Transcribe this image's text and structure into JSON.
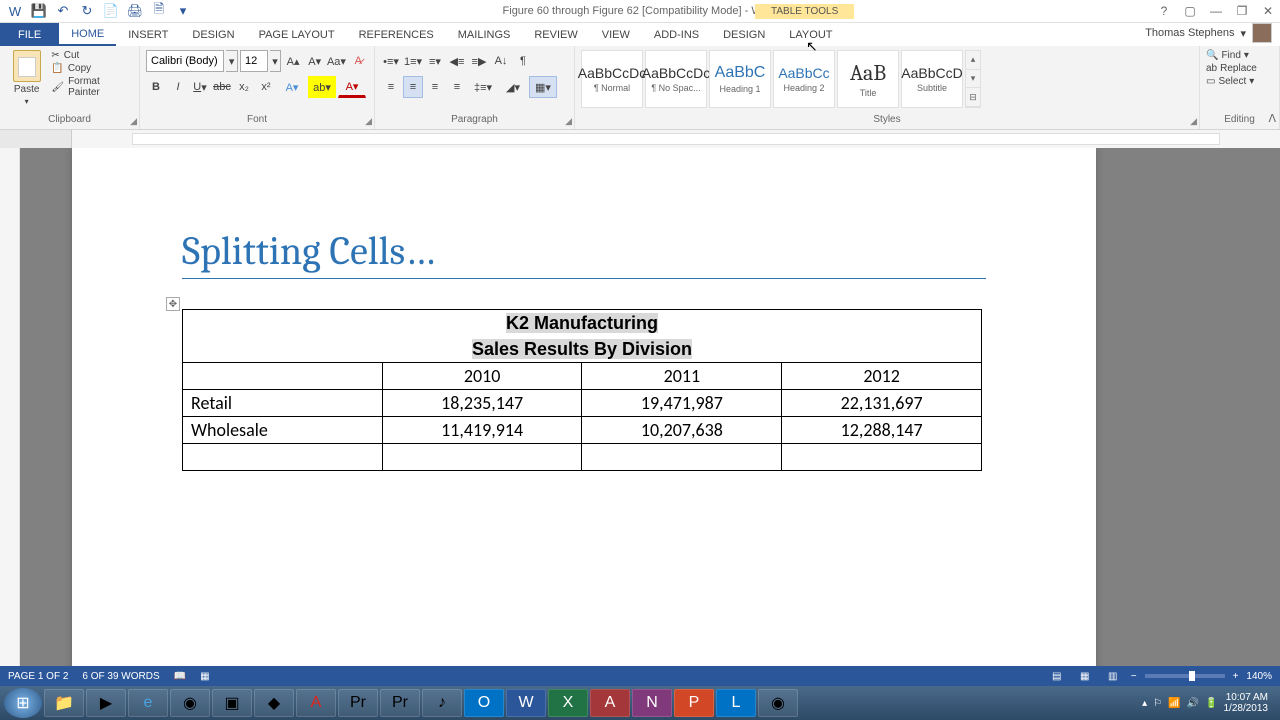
{
  "window": {
    "title": "Figure 60 through Figure 62 [Compatibility Mode] - Word",
    "table_tools": "TABLE TOOLS",
    "user": "Thomas Stephens"
  },
  "tabs": {
    "file": "FILE",
    "home": "HOME",
    "insert": "INSERT",
    "design": "DESIGN",
    "page_layout": "PAGE LAYOUT",
    "references": "REFERENCES",
    "mailings": "MAILINGS",
    "review": "REVIEW",
    "view": "VIEW",
    "addins": "ADD-INS",
    "tt_design": "DESIGN",
    "tt_layout": "LAYOUT"
  },
  "ribbon": {
    "clipboard": {
      "label": "Clipboard",
      "paste": "Paste",
      "cut": "Cut",
      "copy": "Copy",
      "format_painter": "Format Painter"
    },
    "font": {
      "label": "Font",
      "name": "Calibri (Body)",
      "size": "12"
    },
    "paragraph": {
      "label": "Paragraph"
    },
    "styles": {
      "label": "Styles",
      "items": [
        "¶ Normal",
        "¶ No Spac...",
        "Heading 1",
        "Heading 2",
        "Title",
        "Subtitle"
      ],
      "preview": [
        "AaBbCcDc",
        "AaBbCcDc",
        "AaBbC",
        "AaBbCc",
        "AaB",
        "AaBbCcD"
      ]
    },
    "editing": {
      "label": "Editing",
      "find": "Find",
      "replace": "Replace",
      "select": "Select"
    }
  },
  "document": {
    "title": "Splitting Cells…",
    "table": {
      "header1": "K2 Manufacturing",
      "header2": "Sales Results By Division",
      "years": [
        "2010",
        "2011",
        "2012"
      ],
      "rows": [
        {
          "label": "Retail",
          "values": [
            "18,235,147",
            "19,471,987",
            "22,131,697"
          ]
        },
        {
          "label": "Wholesale",
          "values": [
            "11,419,914",
            "10,207,638",
            "12,288,147"
          ]
        }
      ]
    }
  },
  "status": {
    "page": "PAGE 1 OF 2",
    "words": "6 OF 39 WORDS",
    "zoom": "140%"
  },
  "tray": {
    "time": "10:07 AM",
    "date": "1/28/2013"
  }
}
